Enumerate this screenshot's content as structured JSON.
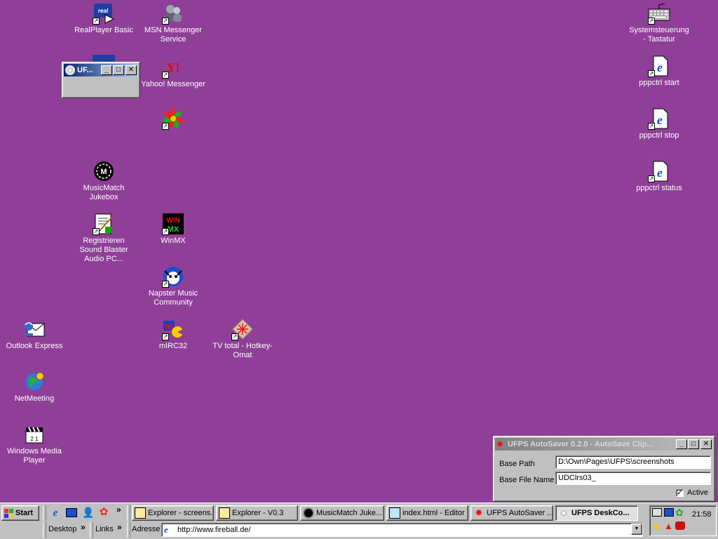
{
  "desktop": {
    "icons": [
      {
        "label": "RealPlayer Basic"
      },
      {
        "label": "MSN Messenger Service"
      },
      {
        "label": "Yahoo! Messenger"
      },
      {
        "label": ""
      },
      {
        "label": "MusicMatch Jukebox"
      },
      {
        "label": "Registrieren Sound Blaster Audio PC..."
      },
      {
        "label": "WinMX"
      },
      {
        "label": "Napster Music Community"
      },
      {
        "label": "Outlook Express"
      },
      {
        "label": "mIRC32"
      },
      {
        "label": "TV total - Hotkey-Omat"
      },
      {
        "label": "NetMeeting"
      },
      {
        "label": "Windows Media Player"
      },
      {
        "label": "Systemsteuerung - Tastatur"
      },
      {
        "label": "pppctrl start"
      },
      {
        "label": "pppctrl stop"
      },
      {
        "label": "pppctrl status"
      }
    ]
  },
  "mini_window": {
    "title": "UF..."
  },
  "autosaver": {
    "title": "UFPS AutoSaver 0.2.0 - AutoSave Clip...",
    "base_path_label": "Base Path",
    "base_path_value": "D:\\Own\\Pages\\UFPS\\screenshots",
    "base_file_label": "Base File Name",
    "base_file_value": "UDClrs03_",
    "active_label": "Active",
    "active_checked": true
  },
  "taskbar": {
    "start_label": "Start",
    "chevron": "»",
    "tasks": [
      {
        "label": "Explorer - screens..."
      },
      {
        "label": "Explorer - V0.3"
      },
      {
        "label": "MusicMatch Juke..."
      },
      {
        "label": "index.html - Editor"
      },
      {
        "label": "UFPS AutoSaver ..."
      },
      {
        "label": "UFPS DeskCo..."
      }
    ],
    "desktop_label": "Desktop",
    "links_label": "Links",
    "address_label": "Adresse",
    "address_value": "http://www.fireball.de/",
    "clock": "21:58"
  },
  "colors": {
    "desktop": "#8f3f98",
    "title_active": "#0a246a",
    "title_inactive": "#808080",
    "face": "#c0c0c0"
  }
}
